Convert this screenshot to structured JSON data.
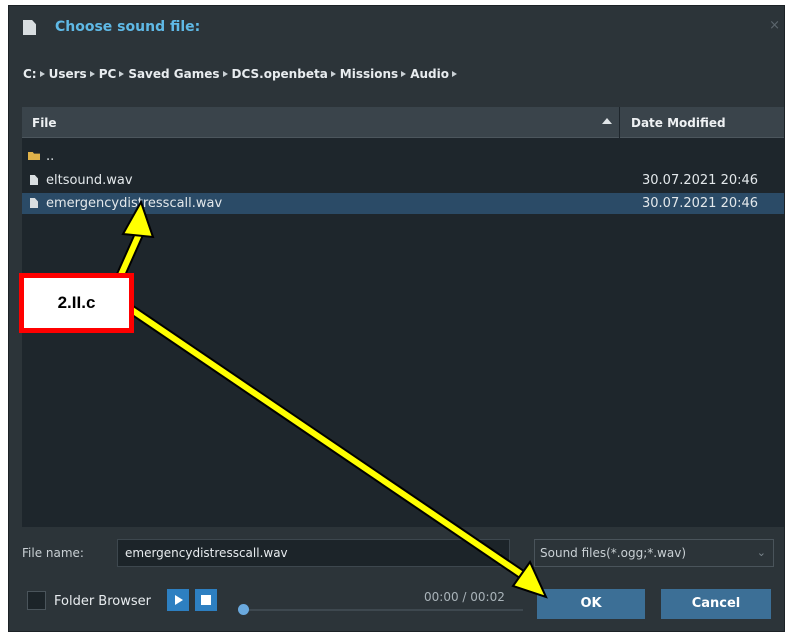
{
  "dialog": {
    "title": "Choose sound file:",
    "close_glyph": "×"
  },
  "breadcrumb": [
    "C:",
    "Users",
    "PC",
    "Saved Games",
    "DCS.openbeta",
    "Missions",
    "Audio"
  ],
  "file_list": {
    "headers": {
      "file": "File",
      "date": "Date Modified"
    },
    "sort_column": "File",
    "sort_direction": "ascending",
    "rows": [
      {
        "type": "folder",
        "name": "..",
        "date": ""
      },
      {
        "type": "file",
        "name": "eltsound.wav",
        "date": "30.07.2021 20:46"
      },
      {
        "type": "file",
        "name": "emergencydistresscall.wav",
        "date": "30.07.2021 20:46",
        "selected": true
      }
    ]
  },
  "footer": {
    "file_name_label": "File name:",
    "file_name_value": "emergencydistresscall.wav",
    "filter_value": "Sound files(*.ogg;*.wav)",
    "folder_browser_label": "Folder Browser",
    "folder_browser_checked": false,
    "time": "00:00 / 00:02",
    "playback_progress": 0,
    "ok_label": "OK",
    "cancel_label": "Cancel"
  },
  "annotation": {
    "label": "2.II.c",
    "box_color": "#ff0000",
    "arrow_color": "#ffff00"
  },
  "colors": {
    "dialog_bg": "#2c3439",
    "title": "#5fb9e6",
    "selection": "#2b4b67",
    "button": "#3c6f96",
    "media_button": "#2d7fc1"
  },
  "icons": [
    "document-icon",
    "close-icon",
    "folder-icon",
    "file-icon",
    "sort-ascending-icon",
    "chevron-down-icon",
    "play-icon",
    "stop-icon"
  ]
}
